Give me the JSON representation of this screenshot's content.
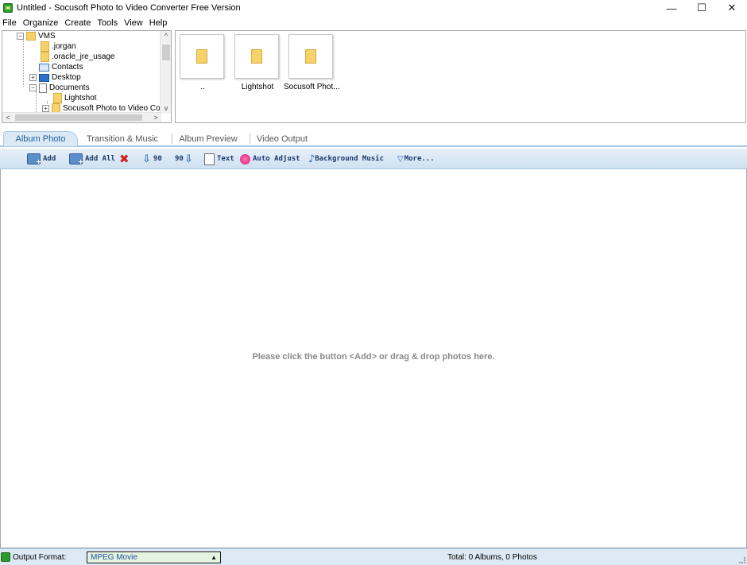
{
  "window": {
    "title": "Untitled - Socusoft Photo to Video Converter Free Version",
    "controls": {
      "minimize": "—",
      "maximize": "☐",
      "close": "✕"
    }
  },
  "menu": [
    "File",
    "Organize",
    "Create",
    "Tools",
    "View",
    "Help"
  ],
  "tree": {
    "items": [
      {
        "label": "VMS",
        "icon": "folder-icon",
        "expander": "−"
      },
      {
        "label": ".jorgan",
        "icon": "folder-icon",
        "expander": ""
      },
      {
        "label": ".oracle_jre_usage",
        "icon": "folder-icon",
        "expander": ""
      },
      {
        "label": "Contacts",
        "icon": "contacts-icon",
        "expander": ""
      },
      {
        "label": "Desktop",
        "icon": "desktop-icon",
        "expander": "+"
      },
      {
        "label": "Documents",
        "icon": "documents-icon",
        "expander": "−"
      },
      {
        "label": "Lightshot",
        "icon": "folder-icon",
        "expander": ""
      },
      {
        "label": "Socusoft Photo to Video Conve",
        "icon": "folder-icon",
        "expander": "+"
      }
    ],
    "scroll_up": "^",
    "scroll_down": "v",
    "scroll_left": "<",
    "scroll_right": ">"
  },
  "thumbnails": [
    {
      "label": "..",
      "icon": "folder-icon"
    },
    {
      "label": "Lightshot",
      "icon": "folder-icon"
    },
    {
      "label": "Socusoft Phot...",
      "icon": "folder-icon"
    }
  ],
  "tabs": [
    {
      "label": "Album Photo",
      "active": true
    },
    {
      "label": "Transition & Music",
      "active": false
    },
    {
      "label": "Album Preview",
      "active": false
    },
    {
      "label": "Video Output",
      "active": false
    }
  ],
  "toolbar": {
    "add": "Add",
    "add_all": "Add All",
    "delete_glyph": "✖",
    "rotate_left": "90",
    "rotate_right": "90",
    "rotate_arrow": "⇩",
    "text": "Text",
    "auto_adjust": "Auto Adjust",
    "background_music": "Background Music",
    "music_glyph": "♪",
    "more": "More...",
    "more_glyph": "▽"
  },
  "drop_area": {
    "hint": "Please click the button <Add> or drag & drop photos here."
  },
  "status": {
    "output_format_label": "Output Format:",
    "output_format_value": "MPEG Movie",
    "caret": "▲",
    "total": "Total: 0 Albums, 0 Photos"
  },
  "colors": {
    "tab_accent": "#1f5f9e",
    "toolbar_bg": "#cfe1f1",
    "status_bg": "#dde9f5",
    "format_select_bg": "#e4f4e0",
    "folder": "#f6d26b",
    "delete": "#d42020"
  }
}
